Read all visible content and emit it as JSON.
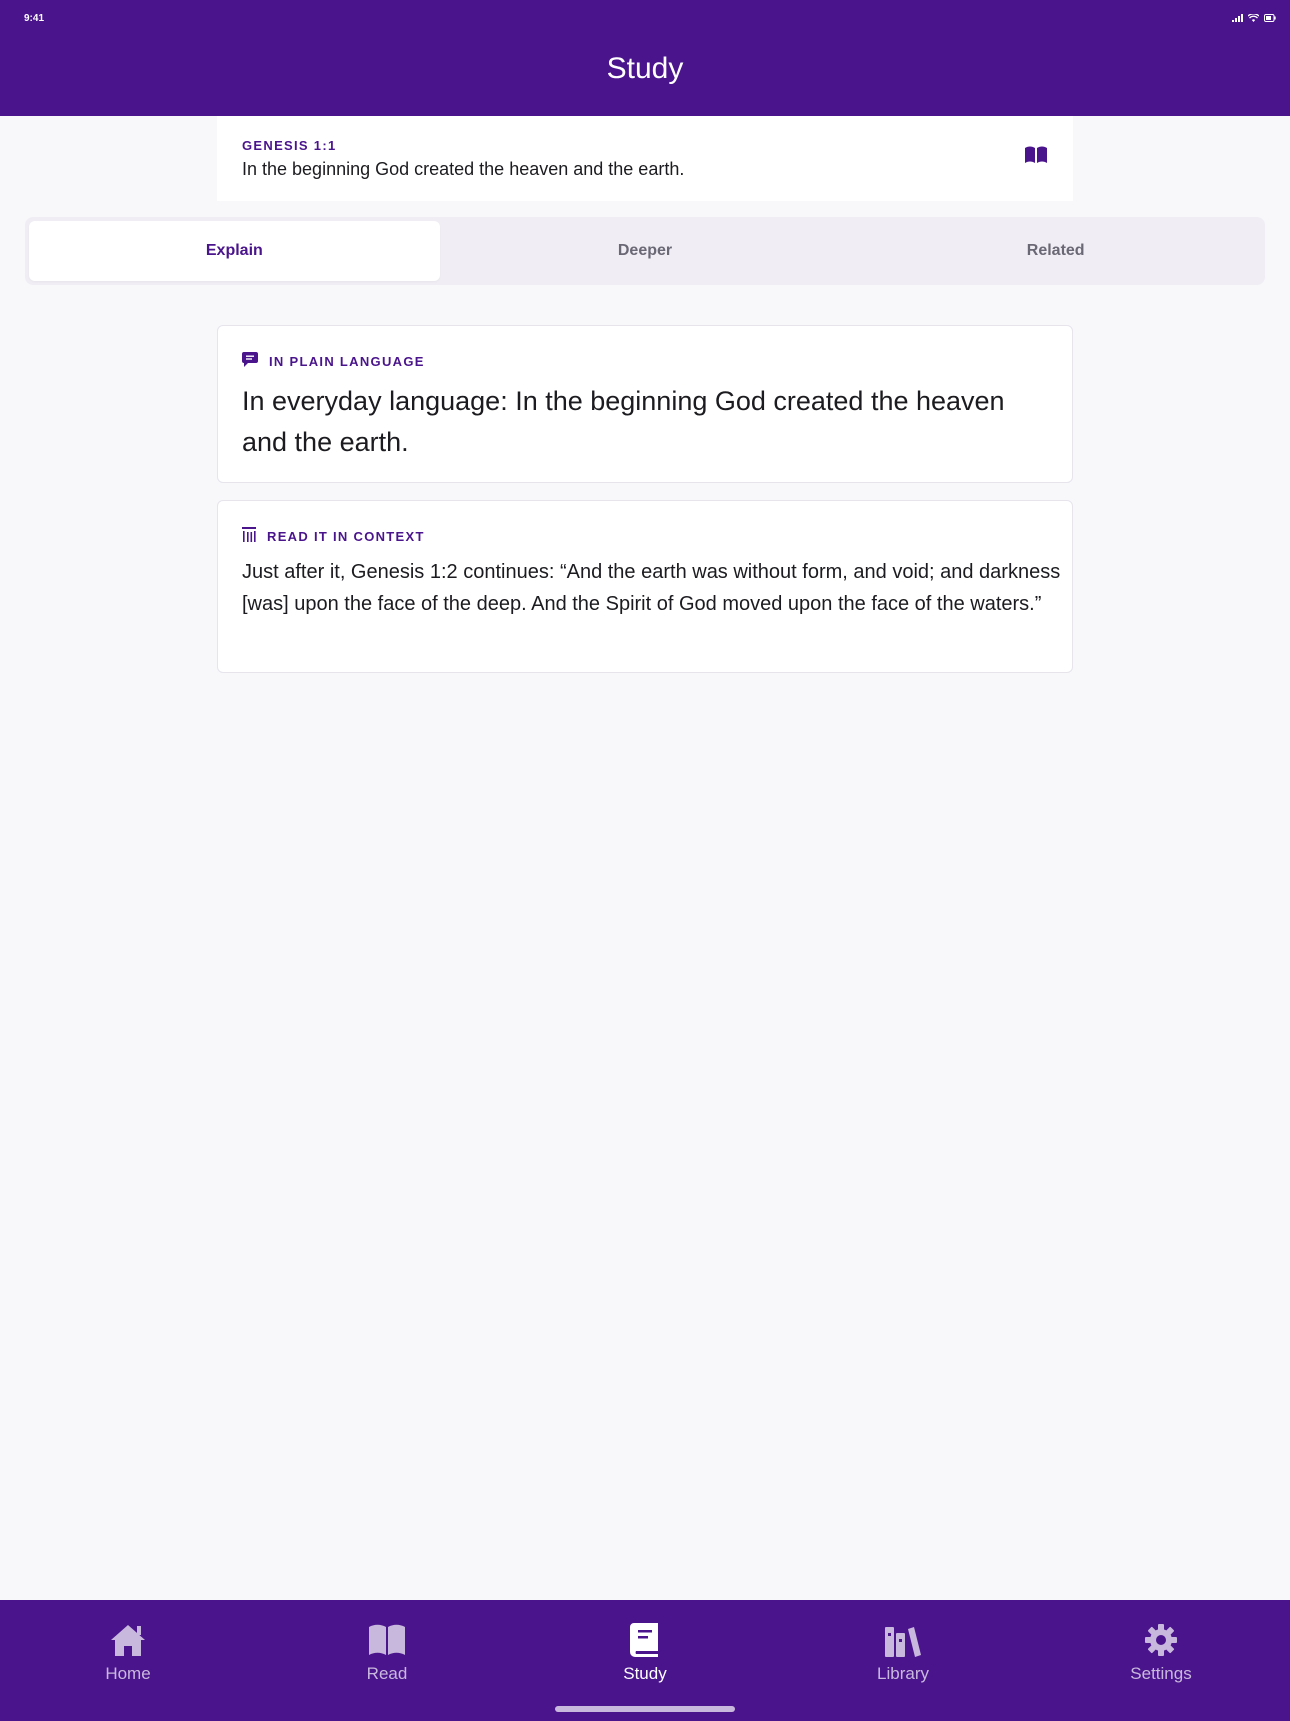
{
  "status_bar": {
    "time": "9:41"
  },
  "header": {
    "title": "Study"
  },
  "verse": {
    "reference": "GENESIS 1:1",
    "text": "In the beginning God created the heaven and the earth."
  },
  "tabs": [
    {
      "label": "Explain",
      "active": true
    },
    {
      "label": "Deeper",
      "active": false
    },
    {
      "label": "Related",
      "active": false
    }
  ],
  "plain_language": {
    "label": "IN PLAIN LANGUAGE",
    "text": "In everyday language: In the beginning God created the heaven and the earth."
  },
  "context": {
    "label": "READ IT IN CONTEXT",
    "text": "Just after it, Genesis 1:2 continues: “And the earth was without form, and void; and darkness [was] upon the face of the deep. And the Spirit of God moved upon the face of the waters.”"
  },
  "bottom_nav": [
    {
      "label": "Home",
      "icon": "home-icon",
      "active": false
    },
    {
      "label": "Read",
      "icon": "book-open-icon",
      "active": false
    },
    {
      "label": "Study",
      "icon": "study-book-icon",
      "active": true
    },
    {
      "label": "Library",
      "icon": "library-icon",
      "active": false
    },
    {
      "label": "Settings",
      "icon": "gear-icon",
      "active": false
    }
  ],
  "colors": {
    "brand": "#4A148C",
    "background": "#F8F8FB",
    "nav_inactive": "#C9B8DD",
    "tab_inactive": "#6B6875"
  }
}
